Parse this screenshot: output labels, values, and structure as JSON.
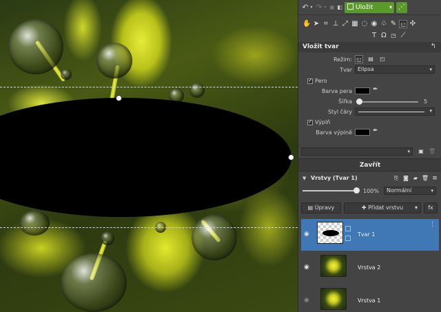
{
  "panel": {
    "save_label": "Uložit",
    "section_title": "Vložit tvar",
    "mode_label": "Režim:",
    "shape_label": "Tvar",
    "shape_value": "Elipsa",
    "pen_label": "Pero",
    "pen_color_label": "Barva pera",
    "width_label": "Šířka",
    "width_value": "5",
    "line_style_label": "Styl čáry",
    "fill_label": "Výplň",
    "fill_color_label": "Barva výplně",
    "close_label": "Zavřít"
  },
  "layers": {
    "header": "Vrstvy (Tvar 1)",
    "opacity": "100%",
    "blend_mode": "Normální",
    "adjust_label": "Úpravy",
    "add_layer_label": "Přidat vrstvu",
    "fx_label": "fx",
    "items": [
      {
        "name": "Tvar 1"
      },
      {
        "name": "Vrstva 2"
      },
      {
        "name": "Vrstva 1"
      }
    ]
  },
  "colors": {
    "accent_green": "#5a9a2a",
    "selected_layer": "#3f78b4",
    "pen_color": "#000000",
    "fill_color": "#000000"
  },
  "icons": [
    "undo-icon",
    "redo-icon",
    "history-icon",
    "compare-icon",
    "save-icon",
    "share-icon",
    "text-icon",
    "omega-icon"
  ]
}
